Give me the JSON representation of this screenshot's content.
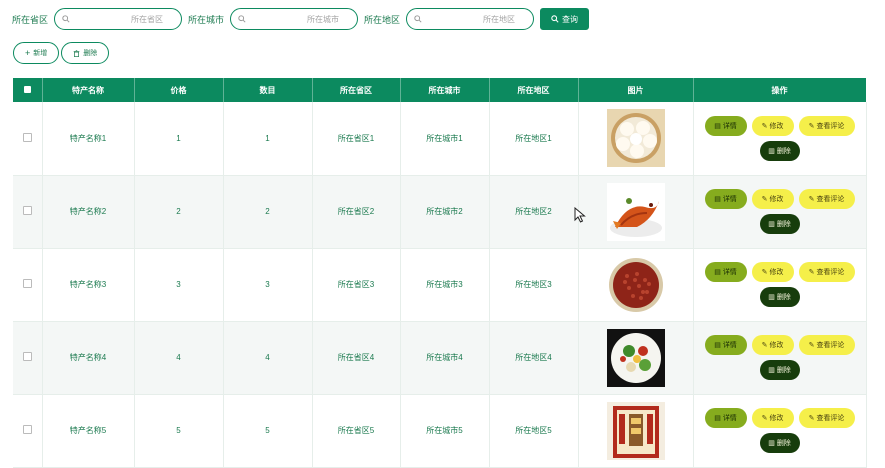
{
  "search": {
    "province_label": "所在省区",
    "province_placeholder": "所在省区",
    "city_label": "所在城市",
    "city_placeholder": "所在城市",
    "district_label": "所在地区",
    "district_placeholder": "所在地区",
    "query_label": "查询"
  },
  "actions": {
    "add_label": "新增",
    "delete_label": "删除"
  },
  "table": {
    "headers": [
      "特产名称",
      "价格",
      "数目",
      "所在省区",
      "所在城市",
      "所在地区",
      "图片",
      "操作"
    ],
    "op_labels": {
      "detail": "详情",
      "edit": "修改",
      "review": "查看评论",
      "delete": "删除"
    },
    "rows": [
      {
        "name": "特产名称1",
        "price": "1",
        "count": "1",
        "province": "所在省区1",
        "city": "所在城市1",
        "district": "所在地区1",
        "image": "steamed-buns"
      },
      {
        "name": "特产名称2",
        "price": "2",
        "count": "2",
        "province": "所在省区2",
        "city": "所在城市2",
        "district": "所在地区2",
        "image": "fish-dish"
      },
      {
        "name": "特产名称3",
        "price": "3",
        "count": "3",
        "province": "所在省区3",
        "city": "所在城市3",
        "district": "所在地区3",
        "image": "red-beans"
      },
      {
        "name": "特产名称4",
        "price": "4",
        "count": "4",
        "province": "所在省区4",
        "city": "所在城市4",
        "district": "所在地区4",
        "image": "salad"
      },
      {
        "name": "特产名称5",
        "price": "5",
        "count": "5",
        "province": "所在省区5",
        "city": "所在城市5",
        "district": "所在地区5",
        "image": "product-box"
      }
    ]
  },
  "colors": {
    "primary": "#0c8a5f",
    "detail_button": "#86ac1e",
    "edit_button": "#f5ef4a",
    "delete_button": "#173d0c"
  }
}
